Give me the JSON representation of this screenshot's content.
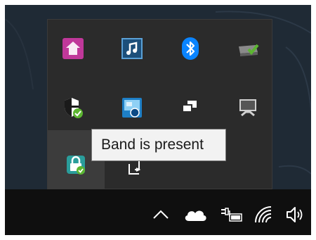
{
  "tooltip": {
    "text": "Band is present"
  },
  "overflow_icons": [
    {
      "name": "pink-house-app-icon"
    },
    {
      "name": "music-note-icon"
    },
    {
      "name": "bluetooth-icon"
    },
    {
      "name": "network-printer-check-icon"
    },
    {
      "name": "security-shield-check-icon"
    },
    {
      "name": "intel-graphics-icon"
    },
    {
      "name": "display-switch-icon"
    },
    {
      "name": "monitor-icon"
    },
    {
      "name": "band-lock-icon"
    },
    {
      "name": "safely-remove-hardware-icon"
    }
  ],
  "taskbar": {
    "icons": [
      "show-hidden-icons-chevron",
      "onedrive-cloud-icon",
      "battery-plug-icon",
      "wifi-icon",
      "volume-icon"
    ]
  },
  "colors": {
    "desktop": "#1f2a35",
    "flyout": "#2b2b2b",
    "taskbar": "#0f0f0f",
    "tooltip_bg": "#f2f2f2",
    "bluetooth": "#0a84ff",
    "pink_app": "#c0389a",
    "teal_app": "#2a9d9b",
    "check_green": "#5cb531"
  }
}
